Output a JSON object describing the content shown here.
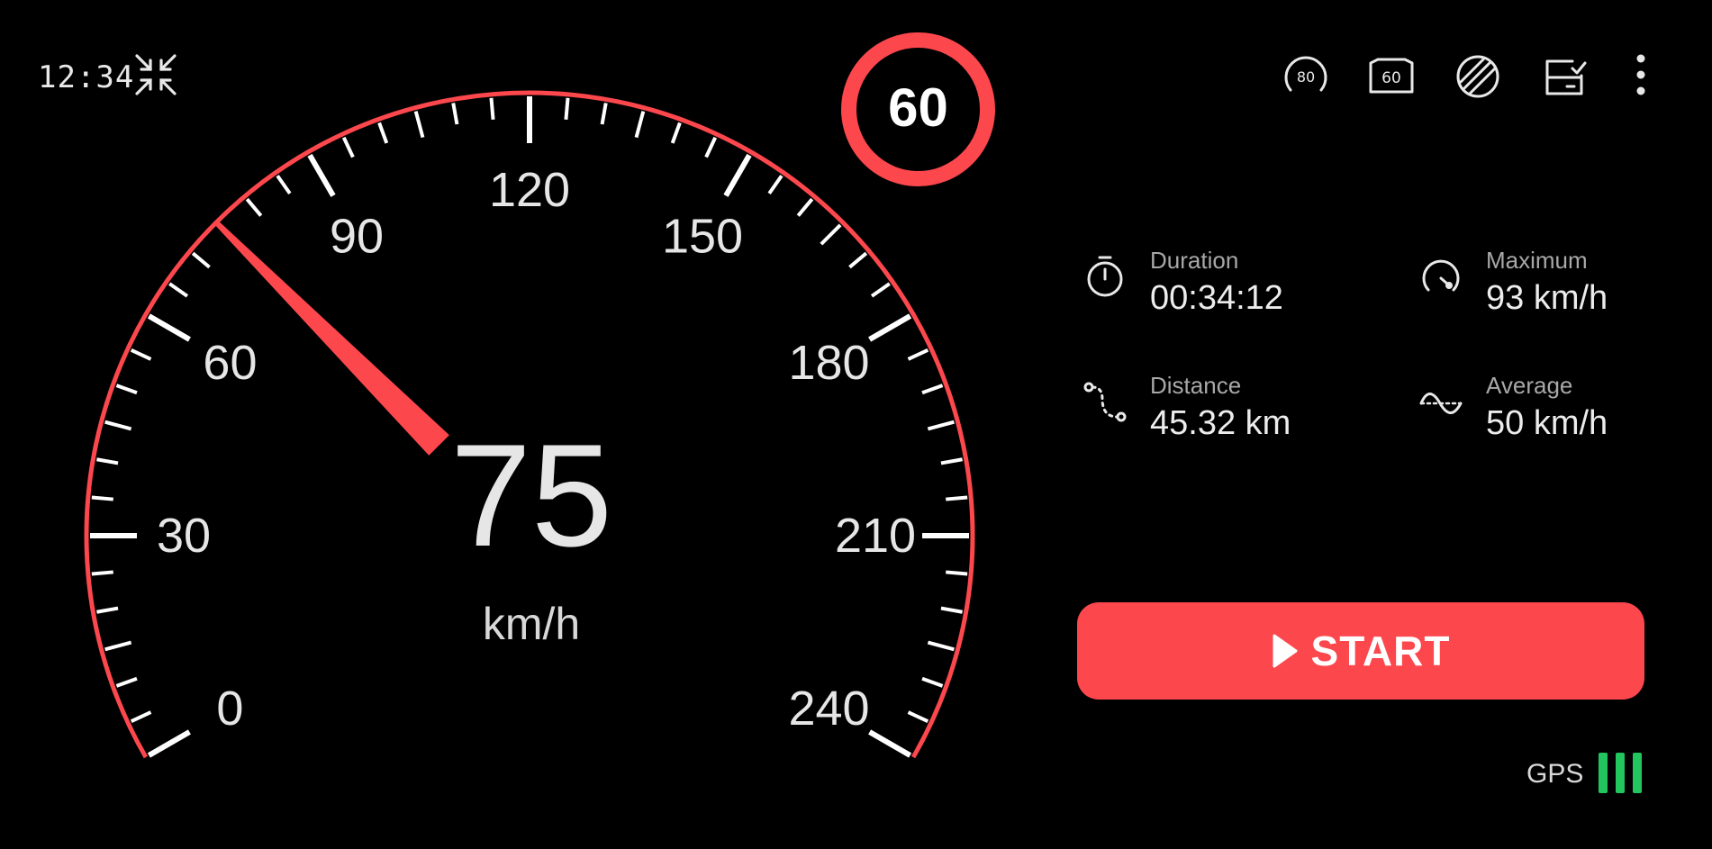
{
  "status": {
    "time": "12:34",
    "gps_label": "GPS",
    "gps_bars": 3,
    "gps_color": "#22c55e"
  },
  "header": {
    "compress_icon": "compress-icon",
    "speed_limit_value": "60",
    "toolbar_icons": [
      {
        "name": "speed-limit-80-icon",
        "label": "80"
      },
      {
        "name": "hud-60-icon",
        "label": "60"
      },
      {
        "name": "night-mode-icon",
        "label": ""
      },
      {
        "name": "history-icon",
        "label": ""
      },
      {
        "name": "more-icon",
        "label": ""
      }
    ]
  },
  "gauge": {
    "min": 0,
    "max": 240,
    "major_step": 30,
    "minor_step": 5,
    "tick_labels": [
      "0",
      "30",
      "60",
      "90",
      "120",
      "150",
      "180",
      "210",
      "240"
    ],
    "needle_value": 75,
    "accent_color": "#fc474d"
  },
  "speed": {
    "value": "75",
    "unit": "km/h"
  },
  "stats": [
    {
      "id": "duration",
      "label": "Duration",
      "value": "00:34:12",
      "icon": "stopwatch-icon"
    },
    {
      "id": "maximum",
      "label": "Maximum",
      "value": "93 km/h",
      "icon": "speedometer-icon"
    },
    {
      "id": "distance",
      "label": "Distance",
      "value": "45.32 km",
      "icon": "route-icon"
    },
    {
      "id": "average",
      "label": "Average",
      "value": "50 km/h",
      "icon": "wave-icon"
    }
  ],
  "start_button": {
    "label": "START",
    "icon": "play-icon",
    "color": "#fc474d"
  }
}
